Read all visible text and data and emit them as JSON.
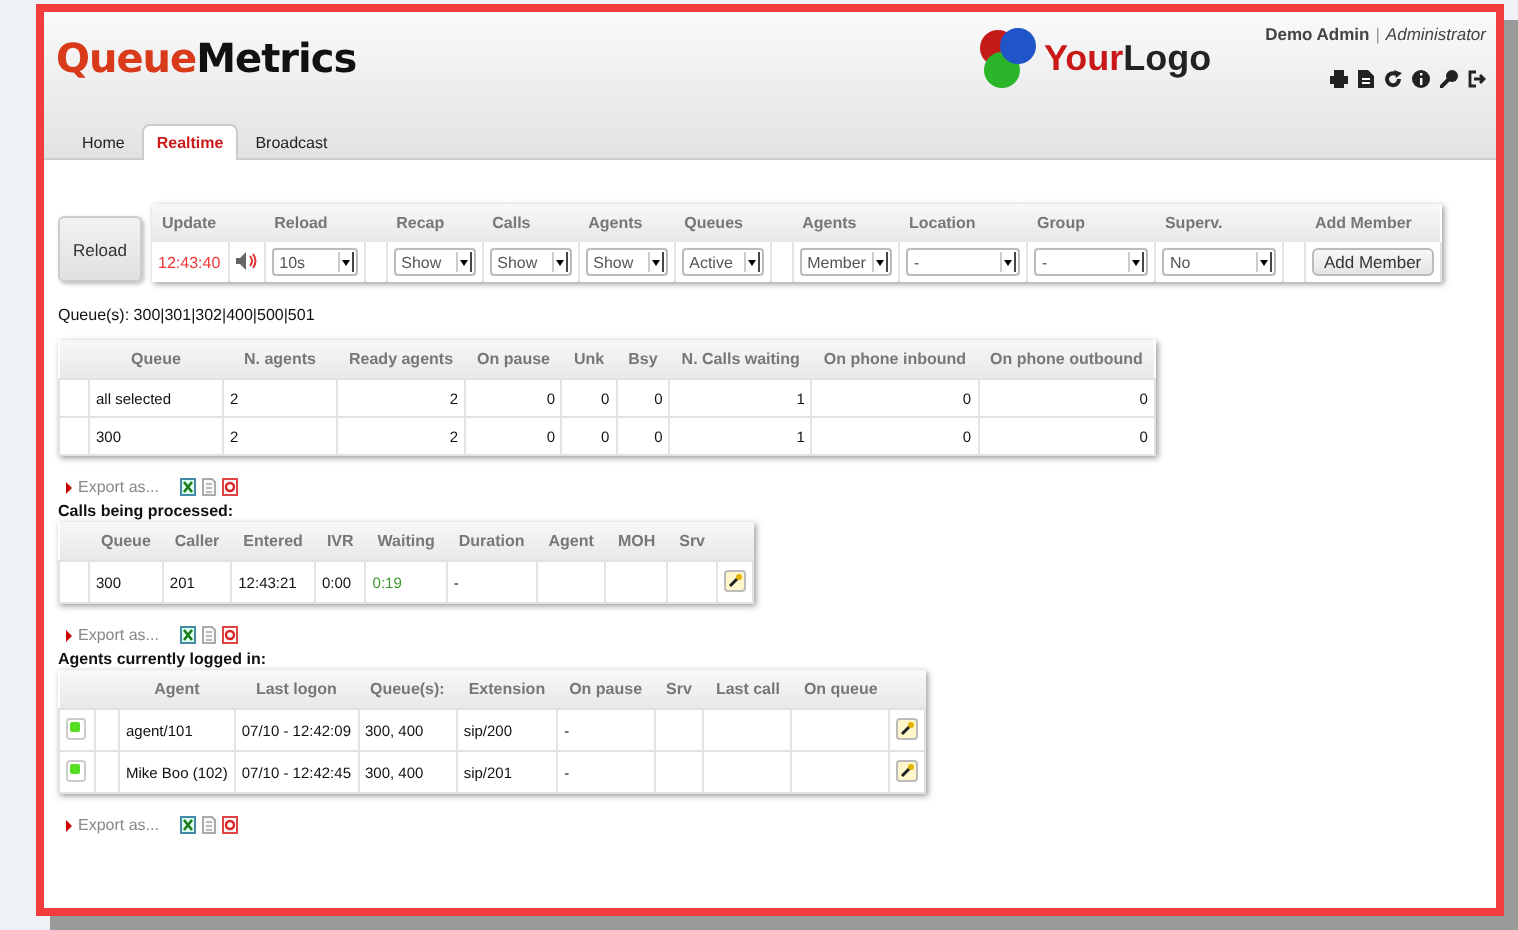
{
  "logo": [
    "Queue",
    "Metrics"
  ],
  "brand_logo": [
    "Your",
    "Logo"
  ],
  "user": {
    "name": "Demo Admin",
    "separator": "|",
    "role": "Administrator"
  },
  "tabs": [
    {
      "label": "Home",
      "selected": false
    },
    {
      "label": "Realtime",
      "selected": true
    },
    {
      "label": "Broadcast",
      "selected": false
    }
  ],
  "reload_button": "Reload",
  "controls": [
    {
      "kind": "time",
      "header": "Update",
      "value": "12:43:40"
    },
    {
      "kind": "sound"
    },
    {
      "kind": "select",
      "header": "Reload",
      "value": "10s"
    },
    {
      "kind": "blank"
    },
    {
      "kind": "select",
      "header": "Recap",
      "value": "Show"
    },
    {
      "kind": "select",
      "header": "Calls",
      "value": "Show"
    },
    {
      "kind": "select",
      "header": "Agents",
      "value": "Show"
    },
    {
      "kind": "select",
      "header": "Queues",
      "value": "Active"
    },
    {
      "kind": "blank"
    },
    {
      "kind": "select",
      "header": "Agents",
      "value": "Member"
    },
    {
      "kind": "select",
      "header": "Location",
      "value": "-"
    },
    {
      "kind": "select",
      "header": "Group",
      "value": "-"
    },
    {
      "kind": "select",
      "header": "Superv.",
      "value": "No"
    },
    {
      "kind": "blank"
    },
    {
      "kind": "button",
      "header": "Add Member",
      "value": "Add Member"
    }
  ],
  "queues_line": "Queue(s): 300|301|302|400|500|501",
  "queue_table": {
    "columns": [
      "Queue",
      "N. agents",
      "Ready agents",
      "On pause",
      "Unk",
      "Bsy",
      "N. Calls waiting",
      "On phone inbound",
      "On phone outbound"
    ],
    "rows": [
      [
        "all selected",
        "2",
        "2",
        "0",
        "0",
        "0",
        "1",
        "0",
        "0"
      ],
      [
        "300",
        "2",
        "2",
        "0",
        "0",
        "0",
        "1",
        "0",
        "0"
      ]
    ]
  },
  "export_labels": [
    "Export as...",
    "Export as...",
    "Export as..."
  ],
  "calls_title": "Calls being processed:",
  "calls_table": {
    "columns": [
      "Queue",
      "Caller",
      "Entered",
      "IVR",
      "Waiting",
      "Duration",
      "Agent",
      "MOH",
      "Srv"
    ],
    "rows": [
      [
        "300",
        "201",
        "12:43:21",
        "0:00",
        "0:19",
        "-",
        "",
        "",
        ""
      ]
    ]
  },
  "agents_title": "Agents currently logged in:",
  "agents_table": {
    "columns": [
      "Agent",
      "Last logon",
      "Queue(s):",
      "Extension",
      "On pause",
      "Srv",
      "Last call",
      "On queue"
    ],
    "rows": [
      {
        "color": "#55dd22",
        "cells": [
          "agent/101",
          "07/10 - 12:42:09",
          "300, 400",
          "sip/200",
          "-",
          "",
          "",
          ""
        ]
      },
      {
        "color": "#55dd22",
        "cells": [
          "Mike Boo (102)",
          "07/10 - 12:42:45",
          "300, 400",
          "sip/201",
          "-",
          "",
          "",
          ""
        ]
      }
    ]
  }
}
